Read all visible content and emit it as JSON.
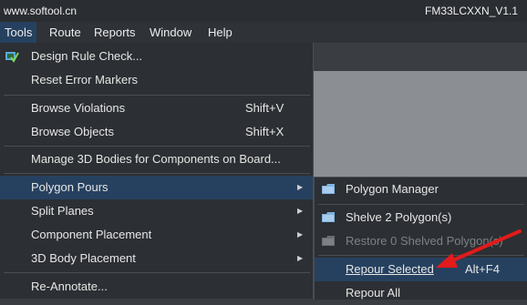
{
  "title_left": "www.softool.cn",
  "title_right": "FM33LCXXN_V1.1",
  "menubar": [
    "Tools",
    "Route",
    "Reports",
    "Window",
    "Help"
  ],
  "tools_menu": {
    "design_rule_check": "Design Rule Check...",
    "reset_error_markers": "Reset Error Markers",
    "browse_violations": "Browse Violations",
    "browse_violations_shortcut": "Shift+V",
    "browse_objects": "Browse Objects",
    "browse_objects_shortcut": "Shift+X",
    "manage_3d_bodies": "Manage 3D Bodies for Components on Board...",
    "polygon_pours": "Polygon Pours",
    "split_planes": "Split Planes",
    "component_placement": "Component Placement",
    "body_placement_3d": "3D Body Placement",
    "re_annotate": "Re-Annotate..."
  },
  "polygon_submenu": {
    "polygon_manager": "Polygon Manager",
    "shelve": "Shelve 2 Polygon(s)",
    "restore": "Restore 0 Shelved Polygon(s)",
    "repour_selected": "Repour Selected",
    "repour_selected_shortcut": "Alt+F4",
    "repour_all": "Repour All"
  },
  "colors": {
    "highlight": "#26415f",
    "menu_background": "#2c2f33",
    "annotation_arrow": "#e21b1b"
  }
}
